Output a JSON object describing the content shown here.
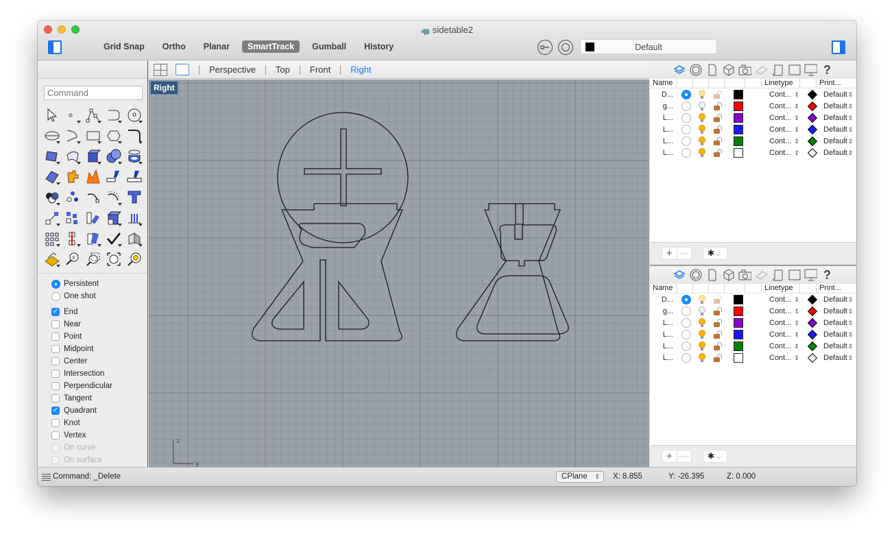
{
  "window": {
    "title": "sidetable2",
    "doc_icon": "rhino-document-icon"
  },
  "toolbar": {
    "modes": [
      {
        "label": "Grid Snap",
        "active": false
      },
      {
        "label": "Ortho",
        "active": false
      },
      {
        "label": "Planar",
        "active": false
      },
      {
        "label": "SmartTrack",
        "active": true
      },
      {
        "label": "Gumball",
        "active": false
      },
      {
        "label": "History",
        "active": false
      }
    ],
    "current_layer": {
      "label": "Default",
      "color": "#000000"
    }
  },
  "command": {
    "placeholder": "Command"
  },
  "tool_palette": {
    "icons": [
      "select-arrow-icon",
      "point-icon",
      "polyline-icon",
      "curve-icon",
      "circle-icon",
      "ellipse-icon",
      "arc-icon",
      "rectangle-icon",
      "polygon-icon",
      "fillet-curve-icon",
      "surface-from-points-icon",
      "surface-icon",
      "box-icon",
      "sphere-union-icon",
      "cylinder-icon",
      "mesh-icon",
      "join-icon",
      "explode-icon",
      "trim-icon",
      "split-icon",
      "boolean-icon",
      "points-icon",
      "curve-edit-icon",
      "offset-icon",
      "text-icon",
      "move-icon",
      "array-icon",
      "rotate-icon",
      "solid-edit-icon",
      "dimension-icon",
      "grid-array-icon",
      "distribute-icon",
      "group-icon",
      "check-icon",
      "shade-icon",
      "light-icon",
      "zoom-icon",
      "zoom-window-icon",
      "zoom-extents-icon",
      "zoom-selected-icon"
    ]
  },
  "osnap": {
    "modes": [
      {
        "label": "Persistent",
        "selected": true
      },
      {
        "label": "One shot",
        "selected": false
      }
    ],
    "snaps": [
      {
        "label": "End",
        "checked": true,
        "enabled": true
      },
      {
        "label": "Near",
        "checked": false,
        "enabled": true
      },
      {
        "label": "Point",
        "checked": false,
        "enabled": true
      },
      {
        "label": "Midpoint",
        "checked": false,
        "enabled": true
      },
      {
        "label": "Center",
        "checked": false,
        "enabled": true
      },
      {
        "label": "Intersection",
        "checked": false,
        "enabled": true
      },
      {
        "label": "Perpendicular",
        "checked": false,
        "enabled": true
      },
      {
        "label": "Tangent",
        "checked": false,
        "enabled": true
      },
      {
        "label": "Quadrant",
        "checked": true,
        "enabled": true
      },
      {
        "label": "Knot",
        "checked": false,
        "enabled": true
      },
      {
        "label": "Vertex",
        "checked": false,
        "enabled": true
      },
      {
        "label": "On curve",
        "checked": false,
        "enabled": false
      },
      {
        "label": "On surface",
        "checked": false,
        "enabled": false
      }
    ]
  },
  "viewport": {
    "tabs": [
      {
        "label": "Perspective",
        "active": false
      },
      {
        "label": "Top",
        "active": false
      },
      {
        "label": "Front",
        "active": false
      },
      {
        "label": "Right",
        "active": true
      }
    ],
    "active_label": "Right",
    "axis_labels": {
      "vertical": "z",
      "horizontal": "y"
    }
  },
  "layers": {
    "panel_icons": [
      "layers-icon",
      "display-icon",
      "document-icon",
      "object-icon",
      "camera-icon",
      "grid-icon",
      "notes-icon",
      "viewport-icon",
      "display-monitor-icon",
      "help-icon"
    ],
    "headers": {
      "name": "Name",
      "linetype": "Linetype",
      "print": "Print..."
    },
    "rows": [
      {
        "name": "D...",
        "current": true,
        "light_on": false,
        "light_dim": true,
        "locked": false,
        "color": "#000000",
        "linetype": "Cont...",
        "print_color": "#000000",
        "print_width": "Default"
      },
      {
        "name": "g...",
        "current": false,
        "light_on": false,
        "light_dim": false,
        "locked": false,
        "color": "#ff0000",
        "linetype": "Cont...",
        "print_color": "#ff0000",
        "print_width": "Default"
      },
      {
        "name": "L...",
        "current": false,
        "light_on": true,
        "light_dim": false,
        "locked": false,
        "color": "#8800cc",
        "linetype": "Cont...",
        "print_color": "#8800cc",
        "print_width": "Default"
      },
      {
        "name": "L...",
        "current": false,
        "light_on": true,
        "light_dim": false,
        "locked": false,
        "color": "#1a1aff",
        "linetype": "Cont...",
        "print_color": "#1a1aff",
        "print_width": "Default"
      },
      {
        "name": "L...",
        "current": false,
        "light_on": true,
        "light_dim": false,
        "locked": false,
        "color": "#008000",
        "linetype": "Cont...",
        "print_color": "#008000",
        "print_width": "Default"
      },
      {
        "name": "L...",
        "current": false,
        "light_on": true,
        "light_dim": false,
        "locked": false,
        "color": "#ffffff",
        "linetype": "Cont...",
        "print_color": "#ffffff",
        "print_width": "Default"
      }
    ],
    "footer": {
      "add": "+",
      "remove": "—",
      "gear": "✱",
      "chevron": "⌄"
    }
  },
  "statusbar": {
    "command": "Command: _Delete",
    "cplane": "CPlane",
    "x": "X: 8.855",
    "y": "Y: -26.395",
    "z": "Z: 0.000"
  }
}
